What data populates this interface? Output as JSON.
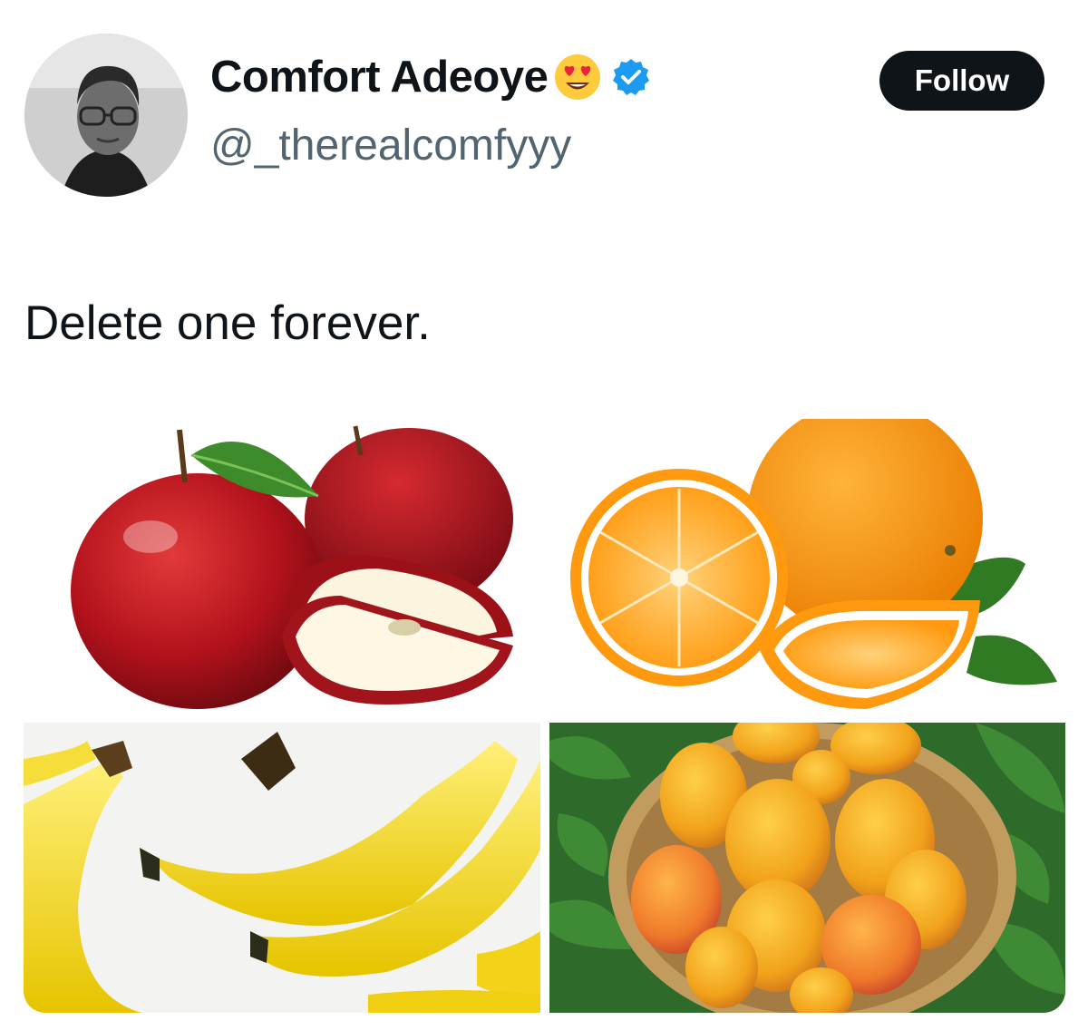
{
  "tweet": {
    "author": {
      "display_name": "Comfort Adeoye",
      "name_emoji": "heart-eyes-emoji",
      "verified_badge": "verified-badge-icon",
      "handle": "@_therealcomfyyy"
    },
    "follow_label": "Follow",
    "text": "Delete one forever.",
    "media": [
      {
        "subject": "apples"
      },
      {
        "subject": "oranges"
      },
      {
        "subject": "bananas"
      },
      {
        "subject": "mangoes"
      }
    ]
  },
  "colors": {
    "text_primary": "#0f1419",
    "text_secondary": "#536471",
    "follow_button_bg": "#0f1419",
    "verified_blue": "#1d9bf0"
  }
}
